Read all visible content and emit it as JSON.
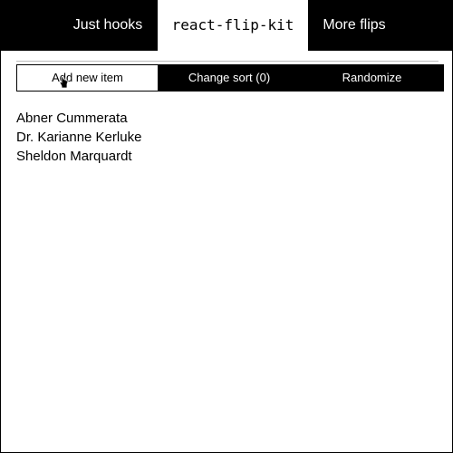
{
  "nav": {
    "tabs": [
      {
        "label": "Just hooks",
        "active": false
      },
      {
        "label": "react-flip-kit",
        "active": true
      },
      {
        "label": "More flips",
        "active": false
      }
    ]
  },
  "toolbar": {
    "add_label": "Add new item",
    "sort_label": "Change sort (0)",
    "randomize_label": "Randomize"
  },
  "list": {
    "items": [
      "Abner Cummerata",
      "Dr. Karianne Kerluke",
      "Sheldon Marquardt"
    ]
  },
  "cursor": {
    "icon": "hand-pointer-icon"
  },
  "colors": {
    "nav_background": "#000000",
    "active_tab_background": "#ffffff",
    "button_dark": "#000000",
    "button_light": "#ffffff"
  }
}
